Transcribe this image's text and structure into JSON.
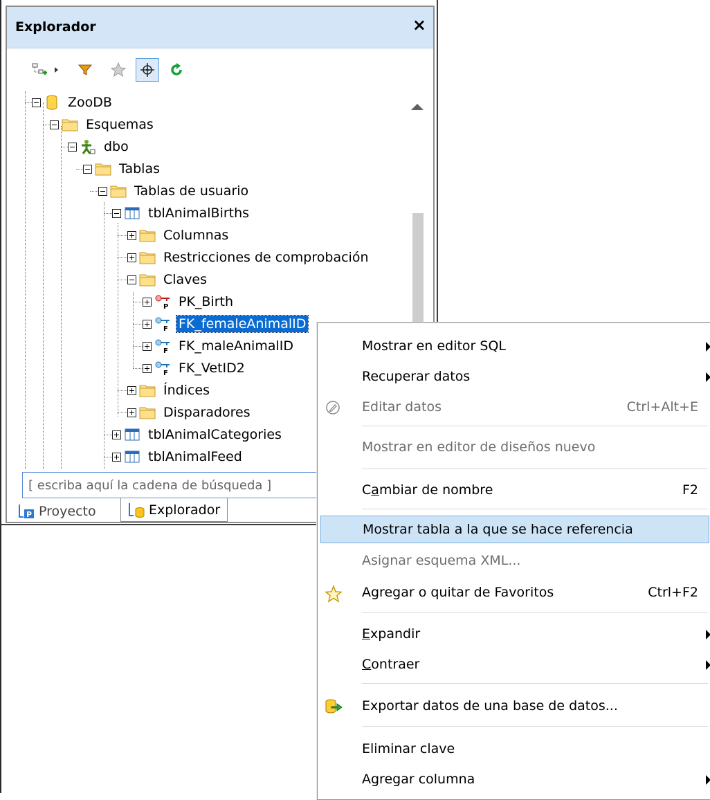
{
  "panel": {
    "title": "Explorador",
    "close_label": "×",
    "toolbar": {
      "icons": [
        "add-connection-icon",
        "dropdown-arrow-icon",
        "filter-icon",
        "favorites-star-icon",
        "locate-icon",
        "refresh-icon"
      ]
    },
    "tree": {
      "nodes": [
        {
          "label": "ZooDB"
        },
        {
          "label": "Esquemas"
        },
        {
          "label": "dbo"
        },
        {
          "label": "Tablas"
        },
        {
          "label": "Tablas de usuario"
        },
        {
          "label": "tblAnimalBirths"
        },
        {
          "label": "Columnas"
        },
        {
          "label": "Restricciones de comprobación"
        },
        {
          "label": "Claves"
        },
        {
          "label": "PK_Birth"
        },
        {
          "label": "FK_femaleAnimalID"
        },
        {
          "label": "FK_maleAnimalID"
        },
        {
          "label": "FK_VetID2"
        },
        {
          "label": "Índices"
        },
        {
          "label": "Disparadores"
        },
        {
          "label": "tblAnimalCategories"
        },
        {
          "label": "tblAnimalFeed"
        }
      ]
    },
    "search_placeholder": "[ escriba aquí la cadena de búsqueda ]",
    "tabs": [
      {
        "label": "Proyecto"
      },
      {
        "label": "Explorador"
      }
    ]
  },
  "menu": {
    "items": [
      {
        "label": "Mostrar en editor SQL"
      },
      {
        "label": "Recuperar datos"
      },
      {
        "label": "Editar datos",
        "shortcut": "Ctrl+Alt+E"
      },
      {
        "label": "Mostrar en editor de diseños nuevo"
      },
      {
        "label_pre": "C",
        "label_u": "a",
        "label_post": "mbiar de nombre",
        "shortcut": "F2"
      },
      {
        "label": "Mostrar tabla a la que se hace referencia"
      },
      {
        "label": "Asignar esquema XML..."
      },
      {
        "label": "Agregar o quitar de Favoritos",
        "shortcut": "Ctrl+F2"
      },
      {
        "label_u": "E",
        "label_post": "xpandir"
      },
      {
        "label_u": "C",
        "label_post": "ontraer"
      },
      {
        "label": "Exportar datos de una base de datos..."
      },
      {
        "label": "Eliminar clave"
      },
      {
        "label": "Agregar columna"
      }
    ]
  }
}
